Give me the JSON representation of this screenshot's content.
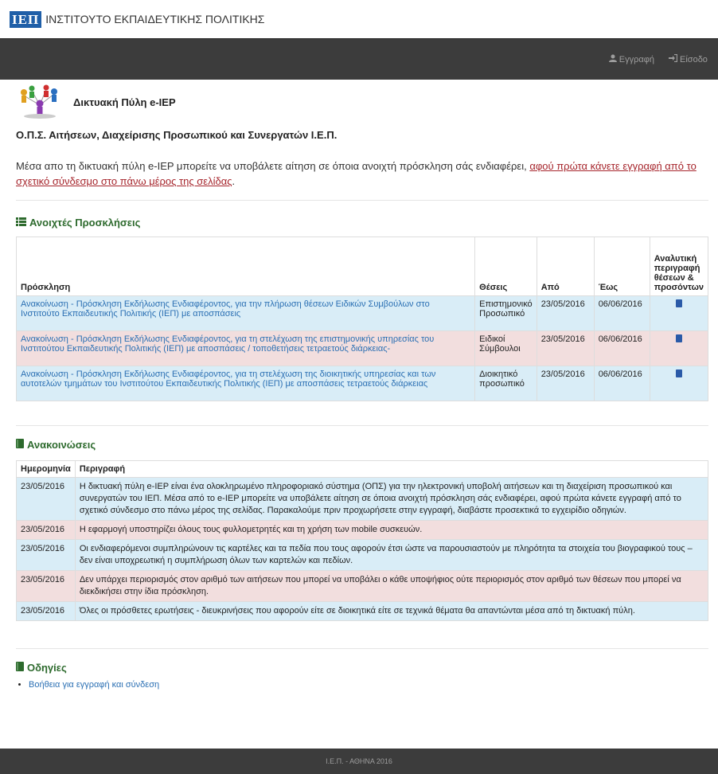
{
  "header": {
    "logo": "ΙΕΠ",
    "org_name": "ΙΝΣΤΙΤΟΥΤΟ ΕΚΠΑΙΔΕΥΤΙΚΗΣ ΠΟΛΙΤΙΚΗΣ"
  },
  "nav": {
    "register": "Εγγραφή",
    "login": "Είσοδο"
  },
  "portal": {
    "title": "Δικτυακή Πύλη e-IEP"
  },
  "ops_title": "Ο.Π.Σ. Αιτήσεων, Διαχείρισης Προσωπικού και Συνεργατών Ι.Ε.Π.",
  "intro": {
    "text": "Μέσα απο τη δικτυακή πύλη e-IEP μπορείτε να υποβάλετε αίτηση σε όποια ανοιχτή πρόσκληση σάς ενδιαφέρει, ",
    "link": "αφού πρώτα κάνετε εγγραφή από το σχετικό σύνδεσμο στο πάνω μέρος της σελίδας",
    "tail": "."
  },
  "invitations": {
    "title": "Ανοιχτές Προσκλήσεις",
    "headers": {
      "invitation": "Πρόσκληση",
      "positions": "Θέσεις",
      "from": "Από",
      "to": "Έως",
      "details": "Αναλυτική περιγραφή θέσεων & προσόντων"
    },
    "rows": [
      {
        "title": "Ανακοίνωση - Πρόσκληση Εκδήλωσης Ενδιαφέροντος, για την πλήρωση θέσεων Ειδικών Συμβούλων στο Ινστιτούτο Εκπαιδευτικής Πολιτικής (ΙΕΠ) με αποσπάσεις",
        "positions": "Επιστημονικό Προσωπικό",
        "from": "23/05/2016",
        "to": "06/06/2016"
      },
      {
        "title": "Ανακοίνωση - Πρόσκληση Εκδήλωσης Ενδιαφέροντος, για τη στελέχωση της επιστημονικής υπηρεσίας του Ινστιτούτου Εκπαιδευτικής Πολιτικής (ΙΕΠ) με αποσπάσεις / τοποθετήσεις τετραετούς διάρκειας-",
        "positions": "Ειδικοί Σύμβουλοι",
        "from": "23/05/2016",
        "to": "06/06/2016"
      },
      {
        "title": "Ανακοίνωση - Πρόσκληση Εκδήλωσης Ενδιαφέροντος, για τη στελέχωση της διοικητικής υπηρεσίας και των αυτοτελών τμημάτων του Ινστιτούτου Εκπαιδευτικής Πολιτικής (ΙΕΠ) με αποσπάσεις τετραετούς διάρκειας",
        "positions": "Διοικητικό προσωπικό",
        "from": "23/05/2016",
        "to": "06/06/2016"
      }
    ]
  },
  "announcements": {
    "title": "Ανακοινώσεις",
    "headers": {
      "date": "Ημερομηνία",
      "description": "Περιγραφή"
    },
    "rows": [
      {
        "date": "23/05/2016",
        "text": "Η δικτυακή πύλη e-IEP είναι ένα ολοκληρωμένο πληροφοριακό σύστημα (ΟΠΣ) για την ηλεκτρονική υποβολή αιτήσεων και τη διαχείριση προσωπικού και συνεργατών του ΙΕΠ. Μέσα από το e-IEP μπορείτε να υποβάλετε αίτηση σε όποια ανοιχτή πρόσκληση σάς ενδιαφέρει, αφού πρώτα κάνετε εγγραφή από το σχετικό σύνδεσμο στο πάνω μέρος της σελίδας. Παρακαλούμε πριν προχωρήσετε στην εγγραφή, διαβάστε προσεκτικά το εγχειρίδιο οδηγιών."
      },
      {
        "date": "23/05/2016",
        "text": "Η εφαρμογή υποστηρίζει όλους τους φυλλομετρητές και τη χρήση των mobile συσκευών."
      },
      {
        "date": "23/05/2016",
        "text": "Οι ενδιαφερόμενοι συμπληρώνουν τις καρτέλες και τα πεδία που τους αφορούν έτσι ώστε να παρουσιαστούν με πληρότητα τα στοιχεία του βιογραφικού τους – δεν είναι υποχρεωτική η συμπλήρωση όλων των καρτελών και πεδίων."
      },
      {
        "date": "23/05/2016",
        "text": "Δεν υπάρχει περιορισμός στον αριθμό των αιτήσεων που μπορεί να υποβάλει ο κάθε υποψήφιος ούτε περιορισμός στον αριθμό των θέσεων που μπορεί να διεκδικήσει στην ίδια πρόσκληση."
      },
      {
        "date": "23/05/2016",
        "text": "Όλες οι πρόσθετες ερωτήσεις - διευκρινήσεις που αφορούν είτε σε διοικητικά είτε σε τεχνικά θέματα θα απαντώνται μέσα από τη δικτυακή πύλη."
      }
    ]
  },
  "guides": {
    "title": "Οδηγίες",
    "items": [
      "Βοήθεια για εγγραφή και σύνδεση"
    ]
  },
  "footer": {
    "text": "Ι.Ε.Π. - ΑΘΗΝΑ 2016"
  }
}
